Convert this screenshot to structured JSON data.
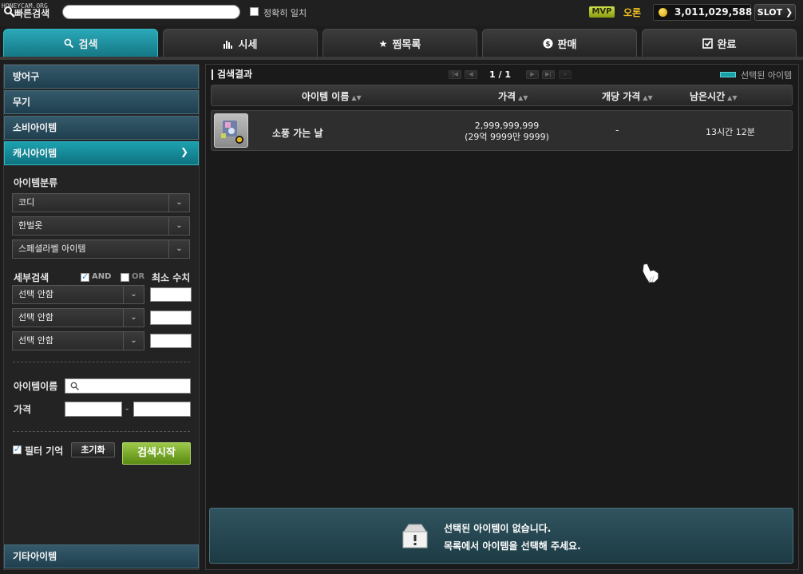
{
  "watermark": "HONEYCAM.ORG",
  "topbar": {
    "quick_search_label": "빠른검색",
    "quick_search_value": "",
    "exact_match_label": "정확히 일치",
    "mvp_badge": "MVP",
    "server_name": "오론",
    "meso": "3,011,029,588",
    "slot_label": "SLOT"
  },
  "tabs": [
    {
      "label": "검색",
      "icon": "search-icon",
      "active": true
    },
    {
      "label": "시세",
      "icon": "bar-chart-icon"
    },
    {
      "label": "찜목록",
      "icon": "star-icon"
    },
    {
      "label": "판매",
      "icon": "sell-icon"
    },
    {
      "label": "완료",
      "icon": "check-icon"
    }
  ],
  "sidebar": {
    "categories": [
      "방어구",
      "무기",
      "소비아이템",
      "캐시아이템"
    ],
    "bottom_category": "기타아이템",
    "item_class_label": "아이템분류",
    "dropdowns": [
      "코디",
      "한벌옷",
      "스페셜라벨 아이템"
    ],
    "detail_search_label": "세부검색",
    "and_label": "AND",
    "or_label": "OR",
    "min_value_label": "최소 수치",
    "detail_options": [
      "선택 안함",
      "선택 안함",
      "선택 안함"
    ],
    "item_name_label": "아이템이름",
    "price_label": "가격",
    "price_dash": "-",
    "filter_memory_label": "필터 기억",
    "reset_label": "초기화",
    "search_start_label": "검색시작"
  },
  "results": {
    "title": "검색결과",
    "page": "1 / 1",
    "selected_legend": "선택된 아이템",
    "columns": [
      "아이템 이름",
      "가격",
      "개당 가격",
      "남은시간"
    ],
    "rows": [
      {
        "name": "소풍 가는 날",
        "price": "2,999,999,999",
        "price_kr": "(29억 9999만 9999)",
        "unit_price": "-",
        "time_left": "13시간 12분"
      }
    ],
    "empty_line1": "선택된 아이템이 없습니다.",
    "empty_line2": "목록에서 아이템을 선택해 주세요."
  },
  "colors": {
    "active_tab": "#1e8e9c",
    "search_button": "#7aa82c",
    "meso_coin": "#e9b215",
    "server": "#f0c020"
  }
}
